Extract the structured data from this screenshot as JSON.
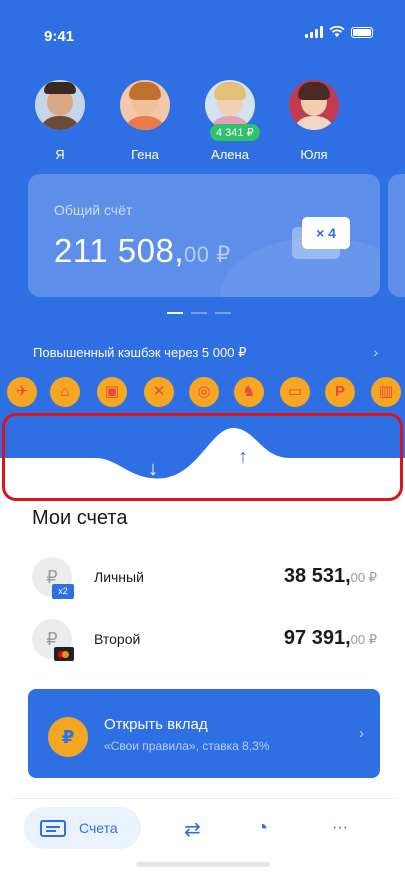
{
  "status_bar": {
    "time": "9:41"
  },
  "people": [
    {
      "name": "Я",
      "badge": ""
    },
    {
      "name": "Гена",
      "badge": ""
    },
    {
      "name": "Алена",
      "badge": "4 341 ₽"
    },
    {
      "name": "Юля",
      "badge": ""
    }
  ],
  "total_card": {
    "label": "Общий счёт",
    "amount_main": "211 508,",
    "amount_frac": "00 ₽",
    "multiplier": "× 4"
  },
  "cashback": {
    "text": "Повышенный кэшбэк через 5 000 ₽"
  },
  "categories": [
    {
      "icon": "airplane-icon",
      "glyph": "✈"
    },
    {
      "icon": "sofa-icon",
      "glyph": "⌂"
    },
    {
      "icon": "train-icon",
      "glyph": "▣"
    },
    {
      "icon": "restaurant-icon",
      "glyph": "✕"
    },
    {
      "icon": "basketball-icon",
      "glyph": "◎"
    },
    {
      "icon": "toy-horse-icon",
      "glyph": "♞"
    },
    {
      "icon": "tv-icon",
      "glyph": "▭"
    },
    {
      "icon": "parking-icon",
      "glyph": "P"
    },
    {
      "icon": "book-icon",
      "glyph": "▥"
    }
  ],
  "switcher": {
    "down_glyph": "↓",
    "up_glyph": "↑"
  },
  "accounts_title": "Мои счета",
  "accounts": [
    {
      "name": "Личный",
      "amount_main": "38 531,",
      "amount_frac": "00 ₽",
      "chip": "x2",
      "currency_glyph": "₽"
    },
    {
      "name": "Второй",
      "amount_main": "97 391,",
      "amount_frac": "00 ₽",
      "chip": "mastercard",
      "currency_glyph": "₽"
    }
  ],
  "deposit": {
    "title": "Открыть вклад",
    "subtitle": "«Свои правила», ставка 8,3%",
    "bag_glyph": "₽"
  },
  "tabbar": {
    "active_label": "Счета",
    "transfer_glyph": "⇄",
    "analytics_glyph": "◔",
    "more_glyph": "···"
  },
  "colors": {
    "primary": "#2f6fe4",
    "accent": "#f5a623",
    "highlight": "#d9141b",
    "badge": "#30c26b"
  }
}
